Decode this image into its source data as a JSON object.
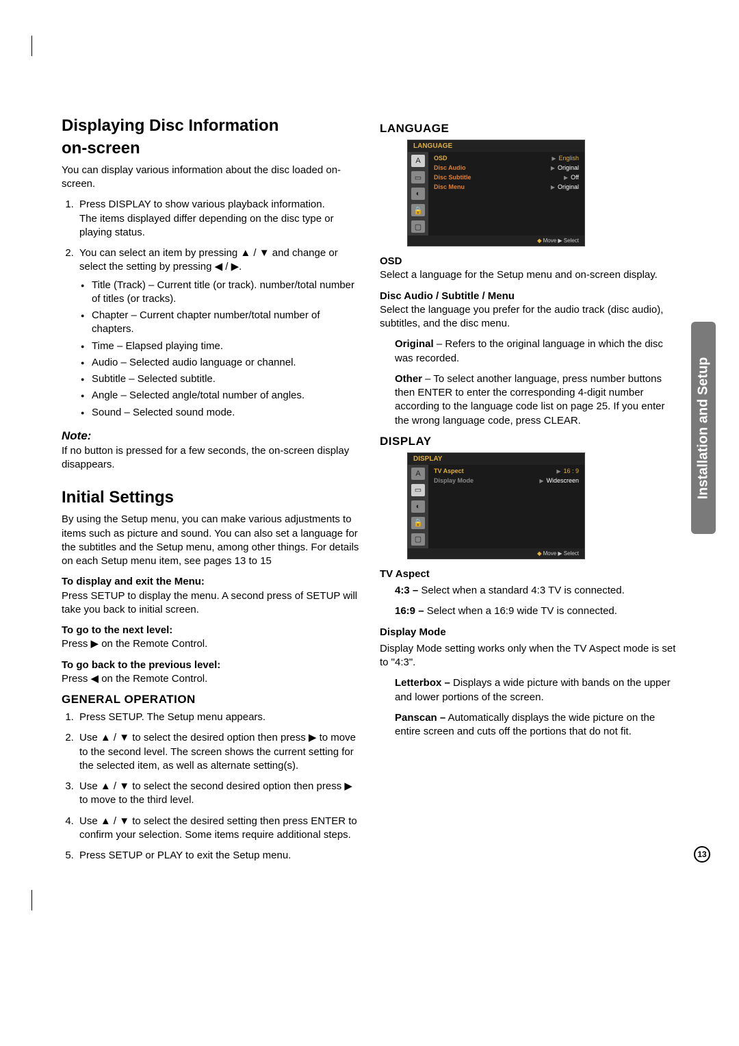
{
  "sideTab": "Installation and Setup",
  "pageNumber": "13",
  "left": {
    "h1a": "Displaying Disc Information",
    "h1b": "on-screen",
    "intro": "You can display various information about the disc loaded on-screen.",
    "step1a": "Press DISPLAY to show various playback information.",
    "step1b": "The items displayed differ depending on the disc type or playing status.",
    "step2": "You can select an item by pressing ▲ / ▼ and change or select the setting by pressing ◀ / ▶.",
    "b1": "Title (Track) – Current title (or track). number/total number of titles (or tracks).",
    "b2": "Chapter – Current chapter number/total number of chapters.",
    "b3": "Time – Elapsed playing time.",
    "b4": "Audio – Selected audio language or channel.",
    "b5": "Subtitle – Selected subtitle.",
    "b6": "Angle – Selected angle/total number of angles.",
    "b7": "Sound – Selected sound mode.",
    "noteLabel": "Note:",
    "note": "If no button is pressed for a few seconds, the on-screen display disappears.",
    "h2": "Initial Settings",
    "initP": "By using the Setup menu, you can make various adjustments to items such as picture and sound. You can also set a language for the subtitles and the Setup menu, among other things. For details on each Setup menu item, see pages 13 to 15",
    "m1t": "To display and exit the Menu:",
    "m1": "Press SETUP to display the menu. A second press of SETUP will take you back to initial screen.",
    "m2t": "To go to the next level:",
    "m2": "Press ▶ on the Remote Control.",
    "m3t": "To go back to the previous level:",
    "m3": "Press ◀ on the Remote Control.",
    "genOp": "GENERAL OPERATION",
    "g1": "Press SETUP. The Setup menu appears.",
    "g2": "Use ▲ / ▼ to select the desired option then press ▶ to move to the second level. The screen shows the current setting for the selected item, as well as alternate setting(s).",
    "g3": "Use ▲ / ▼ to select the second desired option then press ▶ to move to the third level.",
    "g4": "Use ▲ / ▼ to select the desired setting then press ENTER to confirm your selection. Some items require additional steps.",
    "g5": "Press SETUP or PLAY to exit the Setup menu."
  },
  "right": {
    "langH": "LANGUAGE",
    "osd1": {
      "title": "LANGUAGE",
      "rows": [
        {
          "lab": "OSD",
          "val": "English",
          "sel": true
        },
        {
          "lab": "Disc Audio",
          "val": "Original"
        },
        {
          "lab": "Disc Subtitle",
          "val": "Off"
        },
        {
          "lab": "Disc Menu",
          "val": "Original"
        }
      ],
      "foot": "Move      ▶ Select"
    },
    "osdT": "OSD",
    "osdP": "Select a language for the Setup menu and on-screen display.",
    "dasmT": "Disc Audio / Subtitle / Menu",
    "dasmP": "Select the language you prefer for the audio track (disc audio), subtitles, and the disc menu.",
    "origB": "Original",
    "origP": " – Refers to the original language in which the disc was recorded.",
    "otherB": "Other",
    "otherP": " – To select another language, press number buttons then ENTER to enter the corresponding 4-digit number according to the language code list on page 25. If you enter the wrong language code, press CLEAR.",
    "dispH": "DISPLAY",
    "osd2": {
      "title": "DISPLAY",
      "rows": [
        {
          "lab": "TV Aspect",
          "val": "16 : 9",
          "sel": true
        },
        {
          "lab": "Display Mode",
          "val": "Widescreen",
          "gray": true
        }
      ],
      "foot": "Move      ▶ Select"
    },
    "tvaT": "TV Aspect",
    "tva43b": "4:3 –",
    "tva43": " Select when a standard 4:3 TV is connected.",
    "tva169b": "16:9 –",
    "tva169": " Select when a 16:9 wide TV is connected.",
    "dmT": "Display Mode",
    "dmP": "Display Mode setting works only when the TV Aspect mode is set to \"4:3\".",
    "lbB": "Letterbox –",
    "lbP": " Displays a wide picture with bands on the upper and lower portions of the screen.",
    "psB": "Panscan –",
    "psP": " Automatically displays the wide picture on the entire screen and cuts off the portions that do not fit."
  }
}
